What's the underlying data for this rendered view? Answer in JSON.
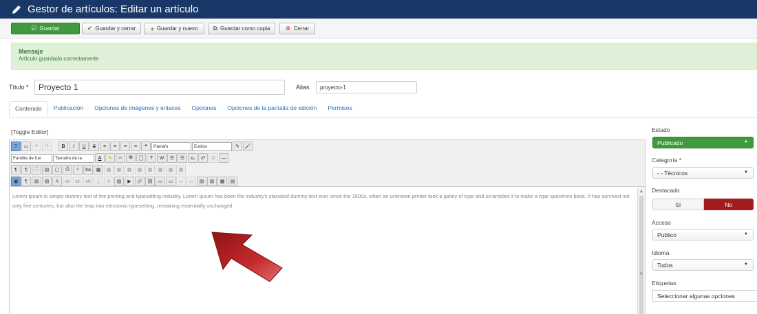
{
  "header": {
    "title": "Gestor de artículos: Editar un artículo"
  },
  "toolbar": {
    "save": "Guardar",
    "save_close": "Guardar y cerrar",
    "save_new": "Guardar y nuevo",
    "save_copy": "Guardar como copia",
    "close": "Cerrar"
  },
  "message": {
    "title": "Mensaje",
    "body": "Artículo guardado correctamente"
  },
  "form": {
    "title_label": "Título *",
    "title_value": "Proyecto 1",
    "alias_label": "Alias",
    "alias_value": "proyecto-1"
  },
  "tabs": [
    "Contenido",
    "Publicación",
    "Opciones de imágenes y enlaces",
    "Opciones",
    "Opciones de la pantalla de edición",
    "Permisos"
  ],
  "editor": {
    "toggle_label": "[Toggle Editor]",
    "format_select": "Párrafo",
    "styles_select": "Estilos",
    "font_family_select": "Familia de fue",
    "font_size_select": "Tamaño de la",
    "body_text": "Lorem Ipsum is simply dummy text of the printing and typesetting industry. Lorem Ipsum has been the industry's standard dummy text ever since the 1500s, when an unknown printer took a galley of type and scrambled it to make a type specimen book. It has survived not only five centuries, but also the leap into electronic typesetting, remaining essentially unchanged"
  },
  "sidebar": {
    "estado_label": "Estado",
    "estado_value": "Publicado",
    "categoria_label": "Categoría *",
    "categoria_value": "- - Técnicos",
    "destacado_label": "Destacado",
    "destacado_yes": "Sí",
    "destacado_no": "No",
    "acceso_label": "Acceso",
    "acceso_value": "Publico",
    "idioma_label": "Idioma",
    "idioma_value": "Todos",
    "etiquetas_label": "Etiquetas",
    "etiquetas_placeholder": "Seleccionar algunas opciones"
  },
  "colors": {
    "header_bg": "#1a3867",
    "primary_green": "#3e9a3c",
    "message_bg": "#dff0d8",
    "no_red": "#a11d1d",
    "arrow_red": "#b8272a"
  }
}
